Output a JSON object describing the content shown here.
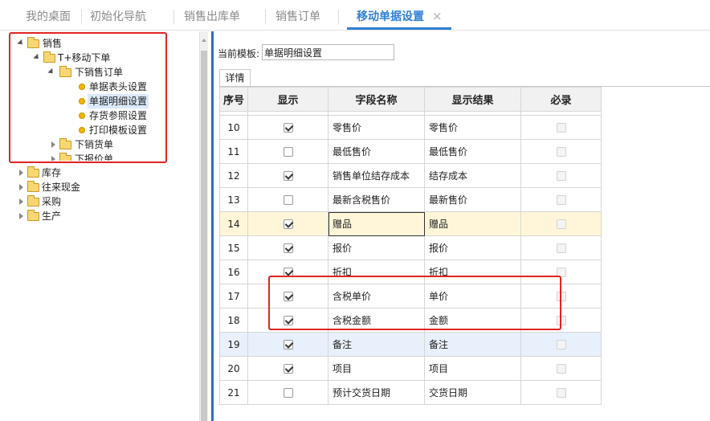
{
  "tabs": [
    {
      "label": "我的桌面",
      "active": false
    },
    {
      "label": "初始化导航",
      "active": false
    },
    {
      "label": "销售出库单",
      "active": false
    },
    {
      "label": "销售订单",
      "active": false
    },
    {
      "label": "移动单据设置",
      "active": true
    }
  ],
  "tab_close": "×",
  "tree": {
    "root": "销售",
    "mobile": "T+移动下单",
    "sales_order": "下销售订单",
    "order_items": [
      "单据表头设置",
      "单据明细设置",
      "存货参照设置",
      "打印模板设置"
    ],
    "delivery": "下销货单",
    "quote": "下报价单",
    "others": [
      "库存",
      "往来现金",
      "采购",
      "生产"
    ]
  },
  "template": {
    "label": "当前模板:",
    "value": "单据明细设置"
  },
  "detail_tab": "详情",
  "grid": {
    "headers": [
      "序号",
      "显示",
      "字段名称",
      "显示结果",
      "必录"
    ],
    "rows": [
      {
        "no": "10",
        "show": true,
        "field": "零售价",
        "result": "零售价",
        "required": false
      },
      {
        "no": "11",
        "show": false,
        "field": "最低售价",
        "result": "最低售价",
        "required": false
      },
      {
        "no": "12",
        "show": true,
        "field": "销售单位结存成本",
        "result": "结存成本",
        "required": false
      },
      {
        "no": "13",
        "show": false,
        "field": "最新含税售价",
        "result": "最新售价",
        "required": false
      },
      {
        "no": "14",
        "show": true,
        "field": "赠品",
        "result": "赠品",
        "required": false
      },
      {
        "no": "15",
        "show": true,
        "field": "报价",
        "result": "报价",
        "required": false
      },
      {
        "no": "16",
        "show": true,
        "field": "折扣",
        "result": "折扣",
        "required": false
      },
      {
        "no": "17",
        "show": true,
        "field": "含税单价",
        "result": "单价",
        "required": false
      },
      {
        "no": "18",
        "show": true,
        "field": "含税金额",
        "result": "金额",
        "required": false
      },
      {
        "no": "19",
        "show": true,
        "field": "备注",
        "result": "备注",
        "required": false
      },
      {
        "no": "20",
        "show": true,
        "field": "项目",
        "result": "项目",
        "required": false
      },
      {
        "no": "21",
        "show": false,
        "field": "预计交货日期",
        "result": "交货日期",
        "required": false
      }
    ]
  },
  "colors": {
    "accent": "#2f7fd6",
    "highlight_row": "#fff6d9",
    "selected_row": "#e7f0fb",
    "annotation": "#e02424"
  }
}
